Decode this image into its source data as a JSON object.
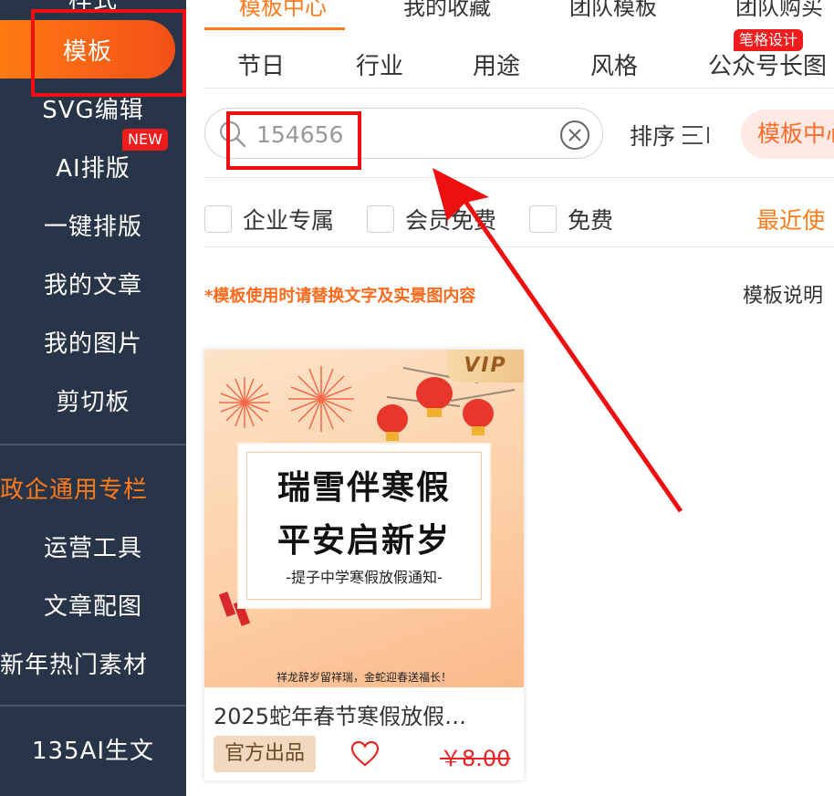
{
  "sidebar": {
    "top_cut_label": "样式",
    "items": [
      {
        "label": "模板"
      },
      {
        "label": "SVG编辑"
      },
      {
        "label": "AI排版"
      },
      {
        "label": "一键排版"
      },
      {
        "label": "我的文章"
      },
      {
        "label": "我的图片"
      },
      {
        "label": "剪切板"
      },
      {
        "label": "政企通用专栏"
      },
      {
        "label": "运营工具"
      },
      {
        "label": "文章配图"
      },
      {
        "label": "新年热门素材"
      },
      {
        "label": "135AI生文"
      }
    ],
    "new_badge": "NEW"
  },
  "top_tabs": [
    {
      "label": "模板中心"
    },
    {
      "label": "我的收藏"
    },
    {
      "label": "团队模板"
    },
    {
      "label": "团队购买"
    }
  ],
  "categories": {
    "items": [
      {
        "label": "节日"
      },
      {
        "label": "行业"
      },
      {
        "label": "用途"
      },
      {
        "label": "风格"
      },
      {
        "label": "公众号长图"
      }
    ],
    "badge": "笔格设计"
  },
  "search": {
    "value": "154656",
    "placeholder": ""
  },
  "sort": {
    "label": "排序"
  },
  "center_pill": "模板中心",
  "filters": [
    {
      "label": "企业专属"
    },
    {
      "label": "会员免费"
    },
    {
      "label": "免费"
    }
  ],
  "recent": "最近使",
  "notice": "*模板使用时请替换文字及实景图内容",
  "explain": "模板说明",
  "card": {
    "vip": "VIP",
    "poster_line1": "瑞雪伴寒假",
    "poster_line2": "平安启新岁",
    "poster_sub": "-提子中学寒假放假通知-",
    "poster_bottom": "祥龙辞岁留祥瑞，金蛇迎春送福长！",
    "title": "2025蛇年春节寒假放假…",
    "official": "官方出品",
    "price": "￥8.00"
  },
  "colors": {
    "sidebar_bg": "#283447",
    "accent": "#ff7a1a",
    "annotation_red": "#ee1010"
  }
}
